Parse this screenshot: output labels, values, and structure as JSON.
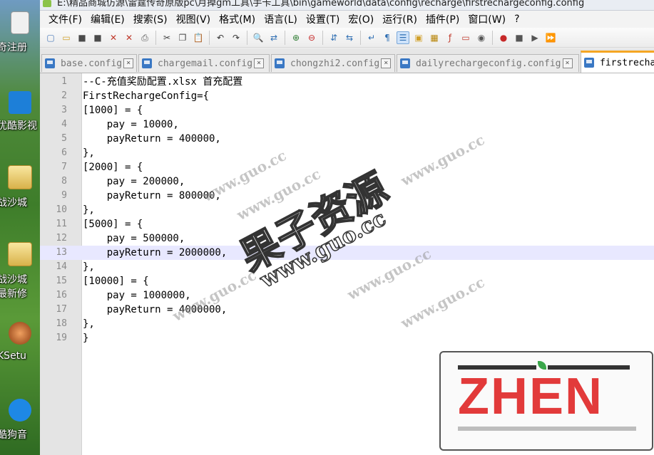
{
  "desktop": {
    "icons": [
      {
        "label": "奇注册",
        "name": "desktop-item-register",
        "glyph": "doc"
      },
      {
        "label": "优酷影视",
        "name": "desktop-item-youku",
        "glyph": "youku"
      },
      {
        "label": "战沙城",
        "name": "desktop-item-shacheng",
        "glyph": "folder"
      },
      {
        "label": "战沙城",
        "name": "desktop-item-shacheng-2",
        "glyph": "folder",
        "sublabel": "最新修"
      },
      {
        "label": "KSetu",
        "name": "desktop-item-ksetup",
        "glyph": "raccoon"
      },
      {
        "label": "酷狗音",
        "name": "desktop-item-kugou",
        "glyph": "kugou"
      }
    ]
  },
  "window": {
    "title": "E:\\精品商城仿源\\雷霆传奇原版pc\\月掉gm工具\\手卡工具\\bin\\gameworld\\data\\config\\recharge\\firstrechargeconfig.config"
  },
  "menu": {
    "items": [
      "文件(F)",
      "编辑(E)",
      "搜索(S)",
      "视图(V)",
      "格式(M)",
      "语言(L)",
      "设置(T)",
      "宏(O)",
      "运行(R)",
      "插件(P)",
      "窗口(W)",
      "?"
    ]
  },
  "toolbar": {
    "buttons": [
      {
        "name": "new-file-icon",
        "sym": "▢",
        "color": "#4a7ab8"
      },
      {
        "name": "open-file-icon",
        "sym": "▭",
        "color": "#d1a02a"
      },
      {
        "name": "save-icon",
        "sym": "■",
        "color": "#4a4a4a"
      },
      {
        "name": "save-all-icon",
        "sym": "■",
        "color": "#4a4a4a"
      },
      {
        "name": "close-file-icon",
        "sym": "✕",
        "color": "#c0392b"
      },
      {
        "name": "close-all-icon",
        "sym": "✕",
        "color": "#c0392b"
      },
      {
        "name": "print-icon",
        "sym": "⎙",
        "color": "#555555"
      },
      {
        "sep": true
      },
      {
        "name": "cut-icon",
        "sym": "✂",
        "color": "#444444"
      },
      {
        "name": "copy-icon",
        "sym": "❐",
        "color": "#444444"
      },
      {
        "name": "paste-icon",
        "sym": "📋",
        "color": "#444444"
      },
      {
        "sep": true
      },
      {
        "name": "undo-icon",
        "sym": "↶",
        "color": "#333333"
      },
      {
        "name": "redo-icon",
        "sym": "↷",
        "color": "#333333"
      },
      {
        "sep": true
      },
      {
        "name": "find-icon",
        "sym": "🔍",
        "color": "#333333"
      },
      {
        "name": "replace-icon",
        "sym": "⇄",
        "color": "#2f6fb3"
      },
      {
        "sep": true
      },
      {
        "name": "zoom-in-icon",
        "sym": "⊕",
        "color": "#2e7d32"
      },
      {
        "name": "zoom-out-icon",
        "sym": "⊖",
        "color": "#c62828"
      },
      {
        "sep": true
      },
      {
        "name": "sync-vertical-icon",
        "sym": "⇵",
        "color": "#2f6fb3"
      },
      {
        "name": "sync-horizontal-icon",
        "sym": "⇆",
        "color": "#2f6fb3"
      },
      {
        "sep": true
      },
      {
        "name": "word-wrap-icon",
        "sym": "↵",
        "color": "#2f6fb3"
      },
      {
        "name": "show-all-chars-icon",
        "sym": "¶",
        "color": "#2f6fb3"
      },
      {
        "name": "indent-guide-icon",
        "sym": "☰",
        "color": "#2f6fb3",
        "active": true
      },
      {
        "name": "user-lang-icon",
        "sym": "▣",
        "color": "#d1a02a"
      },
      {
        "name": "doc-map-icon",
        "sym": "▦",
        "color": "#b8860b"
      },
      {
        "name": "function-list-icon",
        "sym": "ƒ",
        "color": "#c0392b"
      },
      {
        "name": "folder-workspace-icon",
        "sym": "▭",
        "color": "#c0392b"
      },
      {
        "name": "monitor-icon",
        "sym": "◉",
        "color": "#555555"
      },
      {
        "sep": true
      },
      {
        "name": "record-macro-icon",
        "sym": "●",
        "color": "#c62828"
      },
      {
        "name": "stop-macro-icon",
        "sym": "■",
        "color": "#555555"
      },
      {
        "name": "play-macro-icon",
        "sym": "▶",
        "color": "#555555"
      },
      {
        "name": "run-multiple-macro-icon",
        "sym": "⏩",
        "color": "#555555"
      }
    ]
  },
  "tabs": [
    {
      "label": "base.config",
      "name": "tab-base-config"
    },
    {
      "label": "chargemail.config",
      "name": "tab-chargemail-config"
    },
    {
      "label": "chongzhi2.config",
      "name": "tab-chongzhi2-config"
    },
    {
      "label": "dailyrechargeconfig.config",
      "name": "tab-dailyrechargeconfig-config"
    },
    {
      "label": "firstrecha",
      "name": "tab-firstrechargeconfig-config",
      "active": true
    }
  ],
  "editor": {
    "current_line": 13,
    "lines": [
      "--C-充值奖励配置.xlsx 首充配置",
      "FirstRechargeConfig={",
      "[1000] = {",
      "    pay = 10000,",
      "    payReturn = 400000,",
      "},",
      "[2000] = {",
      "    pay = 200000,",
      "    payReturn = 800000,",
      "},",
      "[5000] = {",
      "    pay = 500000,",
      "    payReturn = 2000000,",
      "},",
      "[10000] = {",
      "    pay = 1000000,",
      "    payReturn = 4000000,",
      "},",
      "}"
    ]
  },
  "watermark": {
    "site": "www.guo.cc",
    "brand": "果子资源",
    "stamp": "ZHEN"
  }
}
